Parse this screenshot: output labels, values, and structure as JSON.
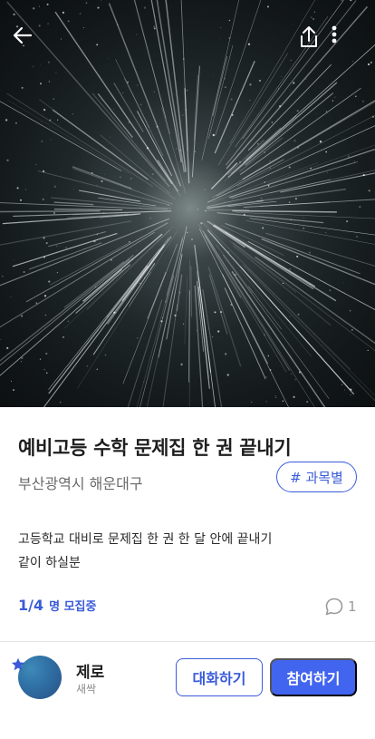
{
  "post": {
    "title": "예비고등 수학 문제집 한 권 끝내기",
    "location": "부산광역시 해운대구",
    "tag": "# 과목별",
    "description_lines": [
      "고등학교 대비로 문제집 한 권 한 달 안에 끝내기",
      "같이 하실분"
    ],
    "recruit_count": "1/4",
    "recruit_label": "명 모집중",
    "comment_count": "1"
  },
  "author": {
    "name": "제로",
    "level": "새싹"
  },
  "actions": {
    "chat_label": "대화하기",
    "join_label": "참여하기"
  },
  "icons": {
    "back": "arrow-left-icon",
    "share": "share-icon",
    "more": "more-vertical-icon",
    "comment": "comment-bubble-icon",
    "badge": "star-icon"
  },
  "colors": {
    "accent": "#3a5bd9",
    "primary_button": "#4265f0",
    "title_text": "#1e1e1e",
    "muted_text": "#6a6a6a"
  }
}
